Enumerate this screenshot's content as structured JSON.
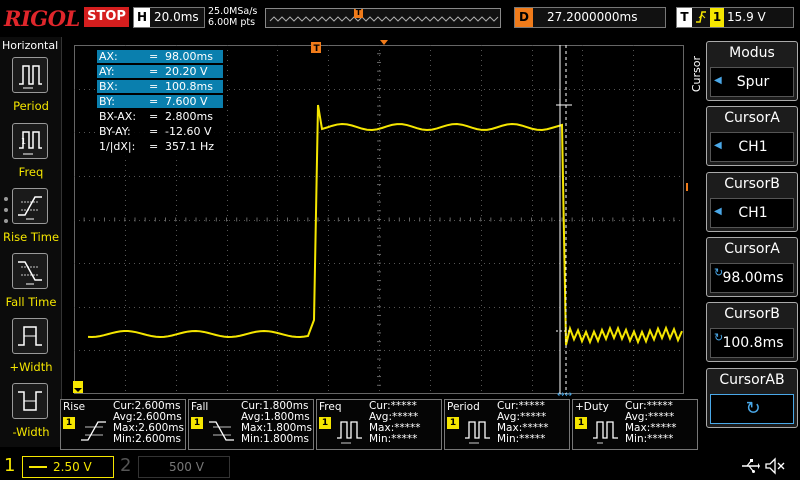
{
  "topbar": {
    "logo": "RIGOL",
    "run_state": "STOP",
    "horizontal_key": "H",
    "timebase": "20.0ms",
    "sample_rate": "25.0MSa/s",
    "memory_depth": "6.00M pts",
    "trigger_marker": "T",
    "delay_key": "D",
    "delay_value": "27.2000000ms",
    "trigger_key": "T",
    "trigger_source": "1",
    "trigger_level": "15.9 V"
  },
  "left_menu": {
    "title": "Horizontal",
    "items": [
      {
        "label": "Period",
        "icon": "period-icon"
      },
      {
        "label": "Freq",
        "icon": "frequency-icon"
      },
      {
        "label": "Rise Time",
        "icon": "rise-time-icon"
      },
      {
        "label": "Fall Time",
        "icon": "fall-time-icon"
      },
      {
        "label": "+Width",
        "icon": "positive-width-icon"
      },
      {
        "label": "-Width",
        "icon": "negative-width-icon"
      }
    ]
  },
  "cursor_readout": {
    "rows": [
      {
        "label": "AX:",
        "eq": "=",
        "value": "98.00ms"
      },
      {
        "label": "AY:",
        "eq": "=",
        "value": "20.20 V"
      },
      {
        "label": "BX:",
        "eq": "=",
        "value": "100.8ms"
      },
      {
        "label": "BY:",
        "eq": "=",
        "value": "7.600 V"
      },
      {
        "label": "BX-AX:",
        "eq": "=",
        "value": "2.800ms"
      },
      {
        "label": "BY-AY:",
        "eq": "=",
        "value": "-12.60 V"
      },
      {
        "label": "1/|dX|:",
        "eq": "=",
        "value": "357.1 Hz"
      }
    ]
  },
  "right_menu": {
    "vertical_label": "Cursor",
    "mode_title": "Modus",
    "mode_value": "Spur",
    "cursor_a_title": "CursorA",
    "cursor_a_source": "CH1",
    "cursor_b_title": "CursorB",
    "cursor_b_source": "CH1",
    "cursor_a_pos_title": "CursorA",
    "cursor_a_pos": "98.00ms",
    "cursor_b_pos_title": "CursorB",
    "cursor_b_pos": "100.8ms",
    "cursor_ab_title": "CursorAB",
    "cursor_ab_symbol": "↻"
  },
  "measurements": [
    {
      "name": "Rise",
      "source": "1",
      "icon": "rise-icon",
      "cur": "Cur:2.600ms",
      "avg": "Avg:2.600ms",
      "max": "Max:2.600ms",
      "min": "Min:2.600ms"
    },
    {
      "name": "Fall",
      "source": "1",
      "icon": "fall-icon",
      "cur": "Cur:1.800ms",
      "avg": "Avg:1.800ms",
      "max": "Max:1.800ms",
      "min": "Min:1.800ms"
    },
    {
      "name": "Freq",
      "source": "1",
      "icon": "freq-icon",
      "cur": "Cur:*****",
      "avg": "Avg:*****",
      "max": "Max:*****",
      "min": "Min:*****"
    },
    {
      "name": "Period",
      "source": "1",
      "icon": "period-icon",
      "cur": "Cur:*****",
      "avg": "Avg:*****",
      "max": "Max:*****",
      "min": "Min:*****"
    },
    {
      "name": "+Duty",
      "source": "1",
      "icon": "duty-icon",
      "cur": "Cur:*****",
      "avg": "Avg:*****",
      "max": "Max:*****",
      "min": "Min:*****"
    }
  ],
  "bottombar": {
    "ch1_number": "1",
    "ch1_scale": "2.50 V",
    "ch2_number": "2",
    "ch2_scale": "500 V"
  },
  "colors": {
    "ch1": "#f5e600",
    "accent": "#4aa8e8",
    "trigger": "#f07b1a",
    "stop": "#d51e1e"
  }
}
